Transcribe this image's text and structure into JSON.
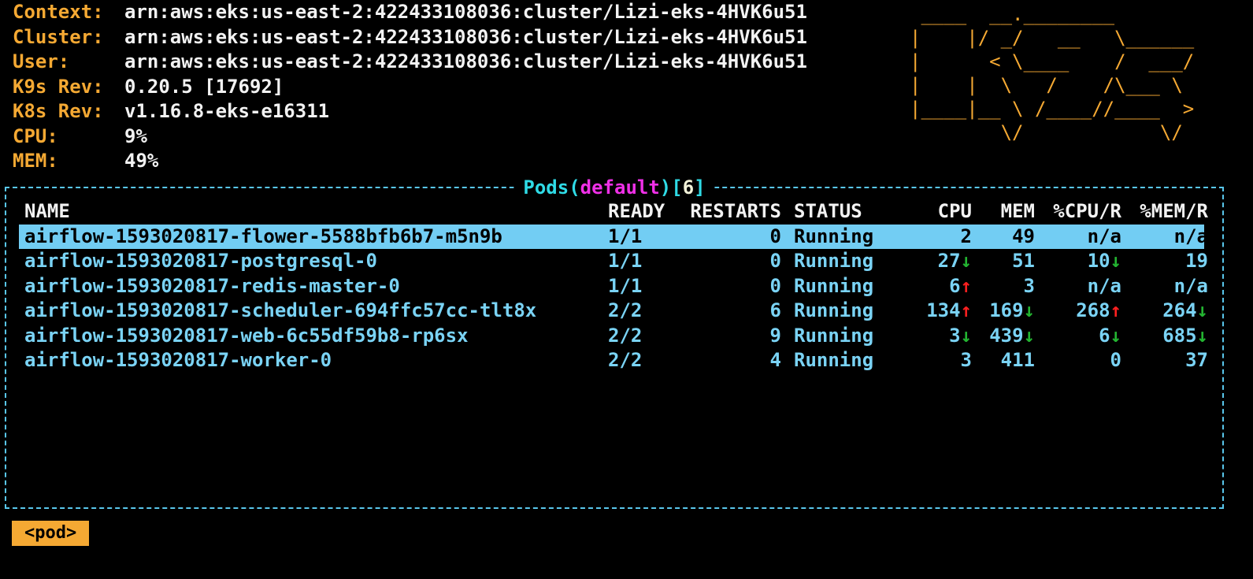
{
  "info": [
    {
      "key": "Context:",
      "value": "arn:aws:eks:us-east-2:422433108036:cluster/Lizi-eks-4HVK6u51"
    },
    {
      "key": "Cluster:",
      "value": "arn:aws:eks:us-east-2:422433108036:cluster/Lizi-eks-4HVK6u51"
    },
    {
      "key": "User:",
      "value": "arn:aws:eks:us-east-2:422433108036:cluster/Lizi-eks-4HVK6u51"
    },
    {
      "key": "K9s Rev:",
      "value": "0.20.5 [17692]"
    },
    {
      "key": "K8s Rev:",
      "value": "v1.16.8-eks-e16311"
    },
    {
      "key": "CPU:",
      "value": "9%"
    },
    {
      "key": "MEM:",
      "value": "49%"
    }
  ],
  "logo": " ____  __.________\n|    |/ _/   __   \\______\n|      < \\____    /  ___/\n|    |  \\   /    /\\___ \\\n|____|__ \\ /____//____  >\n        \\/            \\/",
  "panel": {
    "resource": "Pods",
    "namespace": "default",
    "count": "6"
  },
  "columns": [
    "NAME",
    "READY",
    "RESTARTS",
    "STATUS",
    "CPU",
    "MEM",
    "%CPU/R",
    "%MEM/R"
  ],
  "pods": [
    {
      "name": "airflow-1593020817-flower-5588bfb6b7-m5n9b",
      "ready": "1/1",
      "restarts": "0",
      "status": "Running",
      "cpu": "2",
      "cpu_trend": "",
      "mem": "49",
      "mem_trend": "",
      "pcpur": "n/a",
      "pcpur_trend": "",
      "pmemr": "n/a",
      "pmemr_trend": "",
      "selected": true
    },
    {
      "name": "airflow-1593020817-postgresql-0",
      "ready": "1/1",
      "restarts": "0",
      "status": "Running",
      "cpu": "27",
      "cpu_trend": "↓",
      "mem": "51",
      "mem_trend": "",
      "pcpur": "10",
      "pcpur_trend": "↓",
      "pmemr": "19",
      "pmemr_trend": "",
      "selected": false
    },
    {
      "name": "airflow-1593020817-redis-master-0",
      "ready": "1/1",
      "restarts": "0",
      "status": "Running",
      "cpu": "6",
      "cpu_trend": "↑",
      "mem": "3",
      "mem_trend": "",
      "pcpur": "n/a",
      "pcpur_trend": "",
      "pmemr": "n/a",
      "pmemr_trend": "",
      "selected": false
    },
    {
      "name": "airflow-1593020817-scheduler-694ffc57cc-tlt8x",
      "ready": "2/2",
      "restarts": "6",
      "status": "Running",
      "cpu": "134",
      "cpu_trend": "↑",
      "mem": "169",
      "mem_trend": "↓",
      "pcpur": "268",
      "pcpur_trend": "↑",
      "pmemr": "264",
      "pmemr_trend": "↓",
      "selected": false
    },
    {
      "name": "airflow-1593020817-web-6c55df59b8-rp6sx",
      "ready": "2/2",
      "restarts": "9",
      "status": "Running",
      "cpu": "3",
      "cpu_trend": "↓",
      "mem": "439",
      "mem_trend": "↓",
      "pcpur": "6",
      "pcpur_trend": "↓",
      "pmemr": "685",
      "pmemr_trend": "↓",
      "selected": false
    },
    {
      "name": "airflow-1593020817-worker-0",
      "ready": "2/2",
      "restarts": "4",
      "status": "Running",
      "cpu": "3",
      "cpu_trend": "",
      "mem": "411",
      "mem_trend": "",
      "pcpur": "0",
      "pcpur_trend": "",
      "pmemr": "37",
      "pmemr_trend": "",
      "selected": false
    }
  ],
  "footer": {
    "tag": "<pod>"
  },
  "colors": {
    "accent_orange": "#f5a933",
    "frame_cyan": "#59c7ec",
    "namespace_magenta": "#f030e8",
    "row_text": "#7ad3f5",
    "selected_bg": "#72cdf3",
    "trend_up": "#ff2020",
    "trend_down": "#23b531"
  }
}
